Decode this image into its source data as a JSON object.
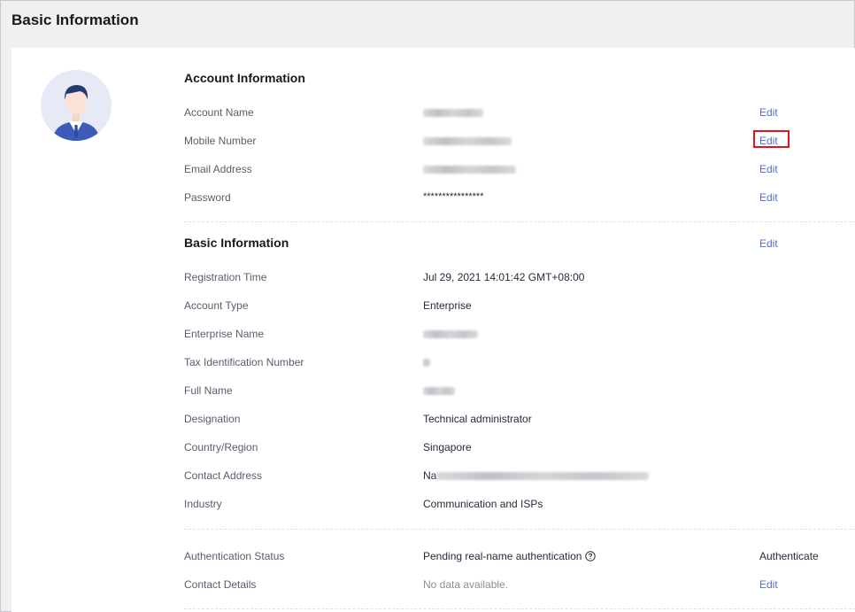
{
  "page": {
    "title": "Basic Information"
  },
  "account_info": {
    "title": "Account Information",
    "rows": [
      {
        "label": "Account Name",
        "value": "",
        "action": "Edit"
      },
      {
        "label": "Mobile Number",
        "value": "",
        "action": "Edit"
      },
      {
        "label": "Email Address",
        "value": "",
        "action": "Edit"
      },
      {
        "label": "Password",
        "value": "****************",
        "action": "Edit"
      }
    ]
  },
  "basic_info": {
    "title": "Basic Information",
    "action": "Edit",
    "rows": [
      {
        "label": "Registration Time",
        "value": "Jul 29, 2021 14:01:42 GMT+08:00"
      },
      {
        "label": "Account Type",
        "value": "Enterprise"
      },
      {
        "label": "Enterprise Name",
        "value": ""
      },
      {
        "label": "Tax Identification Number",
        "value": ""
      },
      {
        "label": "Full Name",
        "value": ""
      },
      {
        "label": "Designation",
        "value": "Technical administrator"
      },
      {
        "label": "Country/Region",
        "value": "Singapore"
      },
      {
        "label": "Contact Address",
        "value": "Na"
      },
      {
        "label": "Industry",
        "value": "Communication and ISPs"
      }
    ]
  },
  "status": {
    "authentication": {
      "label": "Authentication Status",
      "value": "Pending real-name authentication",
      "action": "Authenticate",
      "icon": "help-circle-icon"
    },
    "contact": {
      "label": "Contact Details",
      "value": "No data available.",
      "action": "Edit"
    }
  },
  "colors": {
    "link": "#526ecc",
    "highlight": "#e1141e",
    "avatar_bg": "#e6eaf6"
  }
}
